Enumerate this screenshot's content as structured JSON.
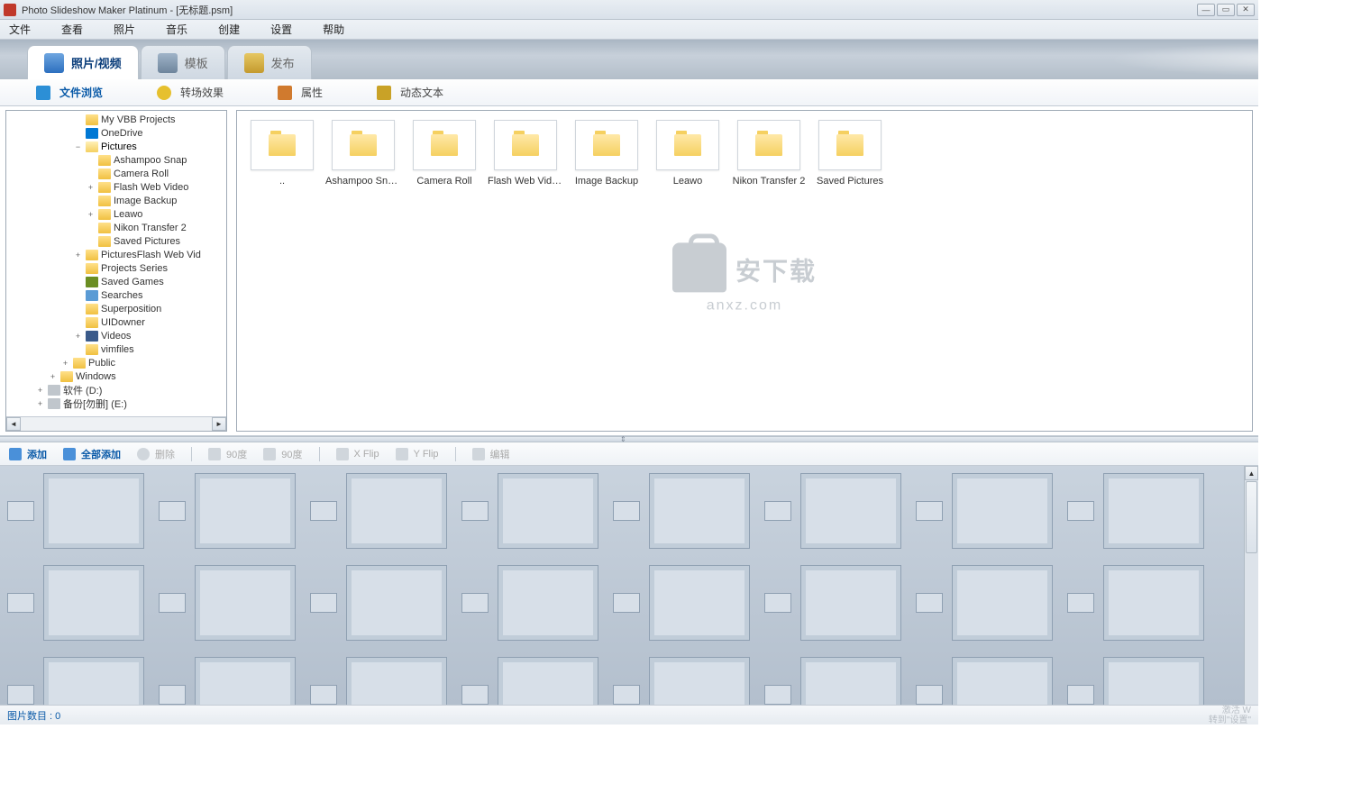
{
  "title": "Photo Slideshow Maker Platinum - [无标题.psm]",
  "menu": [
    "文件",
    "查看",
    "照片",
    "音乐",
    "创建",
    "设置",
    "帮助"
  ],
  "mainTabs": [
    {
      "label": "照片/视频",
      "icon": "ic-photo",
      "active": true
    },
    {
      "label": "模板",
      "icon": "ic-template",
      "active": false
    },
    {
      "label": "发布",
      "icon": "ic-publish",
      "active": false
    }
  ],
  "subTabs": [
    {
      "label": "文件浏览",
      "icon": "ic-browse",
      "active": true
    },
    {
      "label": "转场效果",
      "icon": "ic-trans",
      "active": false
    },
    {
      "label": "属性",
      "icon": "ic-attr",
      "active": false
    },
    {
      "label": "动态文本",
      "icon": "ic-dyn",
      "active": false
    }
  ],
  "tree": [
    {
      "depth": 5,
      "exp": "",
      "icon": "fi-folder",
      "label": "My VBB Projects"
    },
    {
      "depth": 5,
      "exp": "",
      "icon": "fi-cloud",
      "label": "OneDrive"
    },
    {
      "depth": 5,
      "exp": "−",
      "icon": "fi-folder-open",
      "label": "Pictures",
      "sel": true
    },
    {
      "depth": 6,
      "exp": "",
      "icon": "fi-folder",
      "label": "Ashampoo Snap"
    },
    {
      "depth": 6,
      "exp": "",
      "icon": "fi-folder",
      "label": "Camera Roll"
    },
    {
      "depth": 6,
      "exp": "+",
      "icon": "fi-folder",
      "label": "Flash Web Video"
    },
    {
      "depth": 6,
      "exp": "",
      "icon": "fi-folder",
      "label": "Image Backup"
    },
    {
      "depth": 6,
      "exp": "+",
      "icon": "fi-folder",
      "label": "Leawo"
    },
    {
      "depth": 6,
      "exp": "",
      "icon": "fi-folder",
      "label": "Nikon Transfer 2"
    },
    {
      "depth": 6,
      "exp": "",
      "icon": "fi-folder",
      "label": "Saved Pictures"
    },
    {
      "depth": 5,
      "exp": "+",
      "icon": "fi-folder",
      "label": "PicturesFlash Web Vid"
    },
    {
      "depth": 5,
      "exp": "",
      "icon": "fi-folder",
      "label": "Projects Series"
    },
    {
      "depth": 5,
      "exp": "",
      "icon": "fi-game",
      "label": "Saved Games"
    },
    {
      "depth": 5,
      "exp": "",
      "icon": "fi-search",
      "label": "Searches"
    },
    {
      "depth": 5,
      "exp": "",
      "icon": "fi-folder",
      "label": "Superposition"
    },
    {
      "depth": 5,
      "exp": "",
      "icon": "fi-folder",
      "label": "UIDowner"
    },
    {
      "depth": 5,
      "exp": "+",
      "icon": "fi-video",
      "label": "Videos"
    },
    {
      "depth": 5,
      "exp": "",
      "icon": "fi-folder",
      "label": "vimfiles"
    },
    {
      "depth": 4,
      "exp": "+",
      "icon": "fi-folder",
      "label": "Public"
    },
    {
      "depth": 3,
      "exp": "+",
      "icon": "fi-folder",
      "label": "Windows"
    },
    {
      "depth": 2,
      "exp": "+",
      "icon": "fi-drive",
      "label": "软件 (D:)"
    },
    {
      "depth": 2,
      "exp": "+",
      "icon": "fi-drive",
      "label": "备份[勿删] (E:)"
    }
  ],
  "folders": [
    {
      "label": ".."
    },
    {
      "label": "Ashampoo Sna..."
    },
    {
      "label": "Camera Roll"
    },
    {
      "label": "Flash Web Vide..."
    },
    {
      "label": "Image Backup"
    },
    {
      "label": "Leawo"
    },
    {
      "label": "Nikon Transfer 2"
    },
    {
      "label": "Saved Pictures"
    }
  ],
  "watermark": {
    "text1": "安下载",
    "text2": "anxz.com"
  },
  "tlToolbar": {
    "add": "添加",
    "addall": "全部添加",
    "del": "删除",
    "rotl": "90度",
    "rotr": "90度",
    "xflip": "X Flip",
    "yflip": "Y Flip",
    "edit": "编辑"
  },
  "status": {
    "left": "图片数目 : 0",
    "right1": "激活 W",
    "right2": "转到\"设置\""
  }
}
